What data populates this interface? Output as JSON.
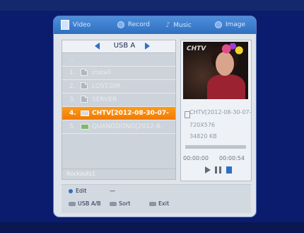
{
  "tabs": [
    {
      "id": "video",
      "label": "Video",
      "icon": "video-icon",
      "active": true
    },
    {
      "id": "record",
      "label": "Record",
      "icon": "record-icon"
    },
    {
      "id": "music",
      "label": "Music",
      "icon": "music-note-icon"
    },
    {
      "id": "image",
      "label": "Image",
      "icon": "image-icon"
    }
  ],
  "usb": {
    "label": "USB A"
  },
  "files": {
    "up_label": "..",
    "rows": [
      {
        "num": "1.",
        "name": "install",
        "type": "folder"
      },
      {
        "num": "2.",
        "name": "LOST.DIR",
        "type": "folder"
      },
      {
        "num": "3.",
        "name": "SERVER",
        "type": "folder"
      },
      {
        "num": "4.",
        "name": "CHTV[2012-08-30-07-",
        "type": "video",
        "selected": true
      },
      {
        "num": "5.",
        "name": "QUANGDONG[2012-8-",
        "type": "video"
      }
    ],
    "footer": "Rockouts1"
  },
  "preview": {
    "channel_logo": "CHTV",
    "filename": "CHTV[2012-08-30-07-",
    "resolution": "720X576",
    "size": "34820 KB",
    "time_current": "00:00:00",
    "time_total": "00:00:54",
    "progress": 0
  },
  "bottom": {
    "edit": "Edit",
    "usb_ab": "USB A/B",
    "sort": "Sort",
    "exit": "Exit",
    "minus_label": "—"
  },
  "colors": {
    "accent_blue": "#2f6fc0",
    "selection_orange": "#f07a00",
    "background": "#0b1c6e"
  }
}
